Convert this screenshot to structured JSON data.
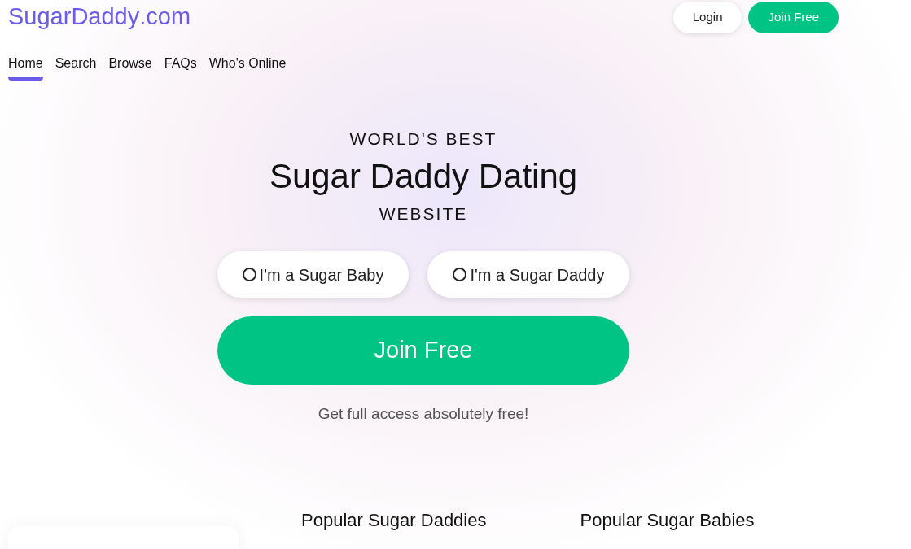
{
  "logo": {
    "name": "SugarDaddy",
    "domain": ".com"
  },
  "header_buttons": [
    {
      "label": "Login",
      "kind": "outline"
    },
    {
      "label": "Join Free",
      "kind": "primary"
    }
  ],
  "nav": [
    {
      "label": "Home",
      "selected": true
    },
    {
      "label": "Search",
      "selected": false
    },
    {
      "label": "Browse",
      "selected": false
    },
    {
      "label": "FAQs",
      "selected": false
    },
    {
      "label": "Who's Online",
      "selected": false
    }
  ],
  "hero": {
    "kicker": "WORLD'S BEST",
    "title": "Sugar Daddy Dating",
    "subtitle": "WEBSITE",
    "options": [
      {
        "label": "I'm a Sugar Baby",
        "selected": false
      },
      {
        "label": "I'm a Sugar Daddy",
        "selected": false
      }
    ],
    "cta": "Join Free",
    "note": "Get full access absolutely free!"
  },
  "sections": [
    "Popular Sugar Daddies",
    "Popular Sugar Babies"
  ]
}
